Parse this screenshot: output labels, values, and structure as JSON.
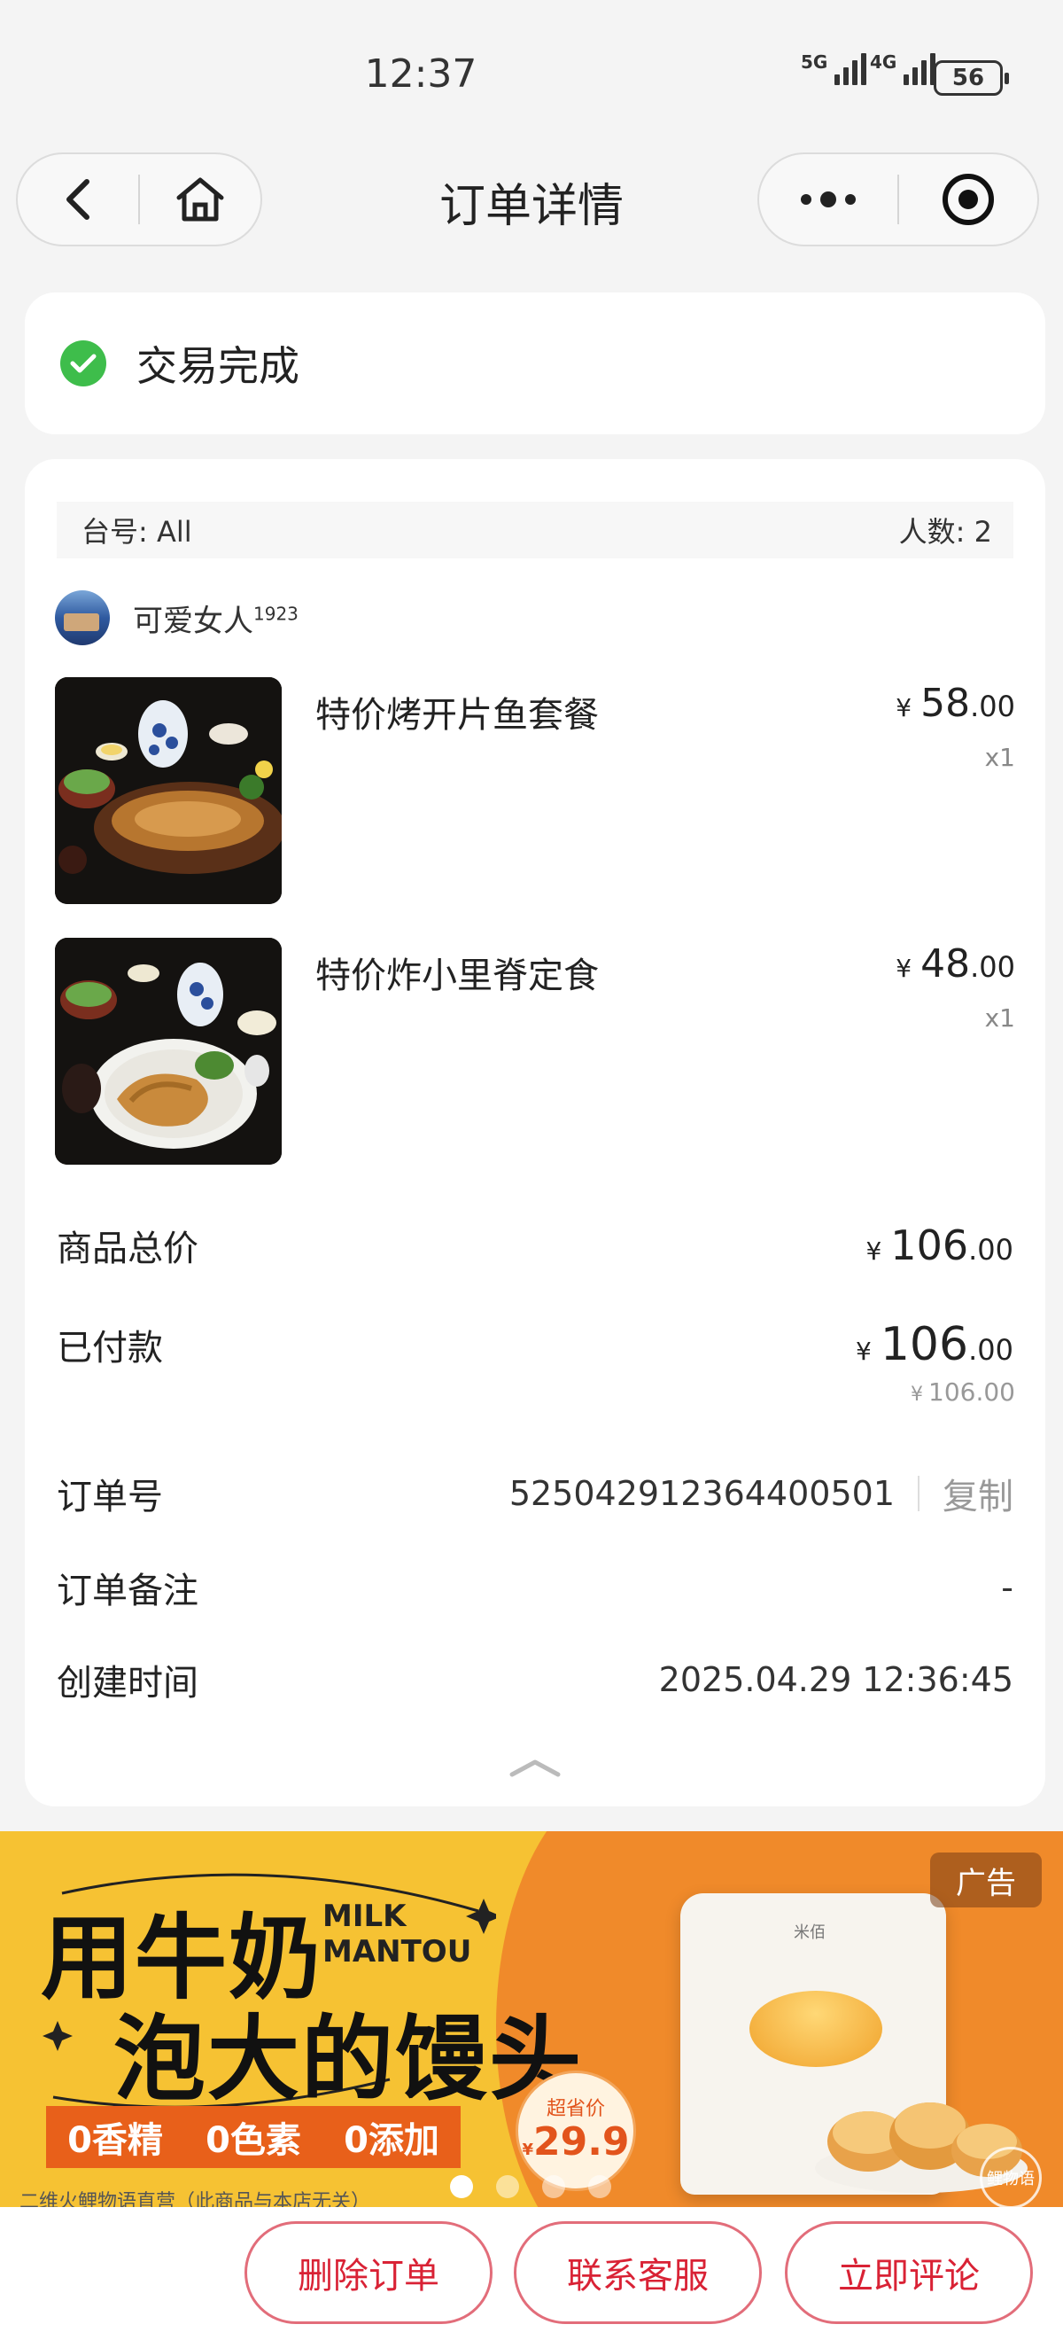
{
  "status_bar": {
    "time": "12:37",
    "signal_1_label": "5G",
    "signal_2_label": "4G",
    "battery": "56"
  },
  "nav": {
    "title": "订单详情",
    "icons": [
      "back-icon",
      "home-icon",
      "more-icon",
      "record-icon"
    ]
  },
  "order_status": {
    "text": "交易完成",
    "icon": "check-circle-icon",
    "color": "#3ebd4b"
  },
  "table": {
    "label": "台号: All",
    "people": "人数: 2"
  },
  "user": {
    "name": "可爱女人",
    "sup": "1923"
  },
  "items": [
    {
      "name": "特价烤开片鱼套餐",
      "currency": "¥",
      "price_int": "58",
      "price_dec": ".00",
      "qty": "x1"
    },
    {
      "name": "特价炸小里脊定食",
      "currency": "¥",
      "price_int": "48",
      "price_dec": ".00",
      "qty": "x1"
    }
  ],
  "summary": {
    "total_label": "商品总价",
    "total_int": "106",
    "total_dec": ".00",
    "paid_label": "已付款",
    "paid_int": "106",
    "paid_dec": ".00",
    "paid_sub": "106.00",
    "currency": "¥"
  },
  "details": {
    "order_no_label": "订单号",
    "order_no": "525042912364400501",
    "copy_label": "复制",
    "note_label": "订单备注",
    "note_value": "-",
    "created_label": "创建时间",
    "created_value": "2025.04.29 12:36:45"
  },
  "ad": {
    "badge": "广告",
    "headline_1": "用牛奶",
    "headline_2": "泡大的馒头",
    "en_1": "MILK",
    "en_2": "MANTOU",
    "tag_1": "0香精",
    "tag_2": "0色素",
    "tag_3": "0添加",
    "price_label": "超省价",
    "price_currency": "¥",
    "price": "29.9",
    "fine_print": "二维火鲤物语直营（此商品与本店无关）",
    "pack_brand": "米佰",
    "watermark": "鲤物语",
    "page_count": 4,
    "active_page": 1,
    "colors": {
      "yellow": "#f6c233",
      "orange": "#f08a2a",
      "tag_bg": "#e8601a"
    }
  },
  "actions": {
    "delete": "删除订单",
    "contact": "联系客服",
    "review": "立即评论",
    "color": "#d92235"
  }
}
